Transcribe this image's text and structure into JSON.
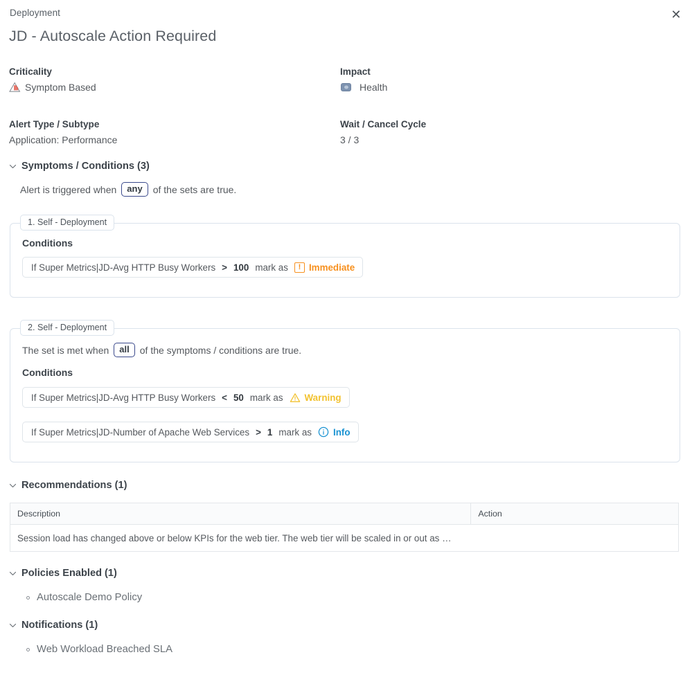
{
  "header": {
    "breadcrumb": "Deployment",
    "title": "JD - Autoscale Action Required",
    "close_icon": "close-icon"
  },
  "meta": {
    "criticality_label": "Criticality",
    "criticality_value": "Symptom Based",
    "criticality_icon": "symptom-based-triangle-icon",
    "impact_label": "Impact",
    "impact_value": "Health",
    "impact_icon": "health-icon",
    "alert_type_label": "Alert Type / Subtype",
    "alert_type_value": "Application: Performance",
    "wait_cancel_label": "Wait / Cancel Cycle",
    "wait_cancel_value": "3 / 3"
  },
  "symptoms": {
    "section_title": "Symptoms / Conditions (3)",
    "trigger_prefix": "Alert is triggered when",
    "trigger_operator": "any",
    "trigger_suffix": "of the sets are true.",
    "sets": [
      {
        "legend": "1. Self - Deployment",
        "set_rule_prefix": "",
        "set_rule_operator": "",
        "set_rule_suffix": "",
        "conditions_title": "Conditions",
        "conditions": [
          {
            "metric": "If Super Metrics|JD-Avg HTTP Busy Workers",
            "operator": ">",
            "value": "100",
            "mark_as": "mark as",
            "severity": "Immediate",
            "severity_key": "immediate",
            "severity_color": "#f7901e"
          }
        ]
      },
      {
        "legend": "2. Self - Deployment",
        "set_rule_prefix": "The set is met when",
        "set_rule_operator": "all",
        "set_rule_suffix": "of the symptoms / conditions are true.",
        "conditions_title": "Conditions",
        "conditions": [
          {
            "metric": "If Super Metrics|JD-Avg HTTP Busy Workers",
            "operator": "<",
            "value": "50",
            "mark_as": "mark as",
            "severity": "Warning",
            "severity_key": "warning",
            "severity_color": "#f2c230"
          },
          {
            "metric": "If Super Metrics|JD-Number of Apache Web Services",
            "operator": ">",
            "value": "1",
            "mark_as": "mark as",
            "severity": "Info",
            "severity_key": "info",
            "severity_color": "#1b93d2"
          }
        ]
      }
    ]
  },
  "recommendations": {
    "section_title": "Recommendations (1)",
    "columns": [
      "Description",
      "Action"
    ],
    "rows": [
      {
        "description": "Session load has changed above or below KPIs for the web tier. The web tier will be scaled in or out as …",
        "action": ""
      }
    ]
  },
  "policies": {
    "section_title": "Policies Enabled (1)",
    "items": [
      "Autoscale Demo Policy"
    ]
  },
  "notifications": {
    "section_title": "Notifications (1)",
    "items": [
      "Web Workload Breached SLA"
    ]
  }
}
